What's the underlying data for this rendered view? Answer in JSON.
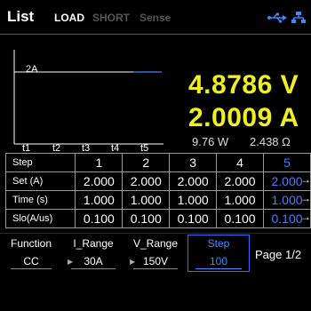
{
  "header": {
    "title": "List",
    "tabs": [
      {
        "label": "LOAD",
        "active": true
      },
      {
        "label": "SHORT",
        "active": false
      },
      {
        "label": "Sense",
        "active": false
      }
    ],
    "icons": [
      "usb-icon",
      "network-icon"
    ]
  },
  "graph": {
    "y_label": "2A",
    "t_labels": [
      "t1",
      "t2",
      "t3",
      "t4",
      "t5"
    ],
    "line_color": "#4a7cff"
  },
  "readout": {
    "voltage": "4.8786 V",
    "current": "2.0009 A",
    "power": "9.76 W",
    "resistance": "2.438 Ω",
    "main_color": "#f0f020"
  },
  "table": {
    "header": "Step",
    "steps": [
      "1",
      "2",
      "3",
      "4",
      "5"
    ],
    "rows": [
      {
        "label": "Set (A)",
        "values": [
          "2.000",
          "2.000",
          "2.000",
          "2.000",
          "2.000"
        ]
      },
      {
        "label": "Time (s)",
        "values": [
          "1.000",
          "1.000",
          "1.000",
          "1.000",
          "1.000"
        ]
      },
      {
        "label": "Slo(A/us)",
        "values": [
          "0.100",
          "0.100",
          "0.100",
          "0.100",
          "0.100"
        ]
      }
    ],
    "selected_step": "5",
    "selected_color": "#4a7cff",
    "arrow": "→"
  },
  "softkeys": {
    "function": {
      "label": "Function",
      "value": "CC"
    },
    "i_range": {
      "label": "I_Range",
      "value": "30A"
    },
    "v_range": {
      "label": "V_Range",
      "value": "150V"
    },
    "step": {
      "label": "Step",
      "value": "100"
    },
    "page": "Page 1/2"
  }
}
